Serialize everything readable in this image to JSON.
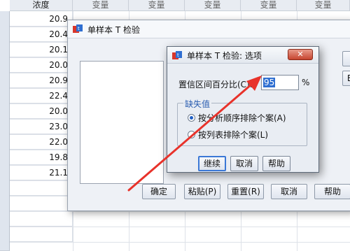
{
  "sheet": {
    "column_header": "浓度",
    "var_header": "变量",
    "var_columns": 5,
    "values": [
      "20.9",
      "20.4",
      "20.1",
      "20.0",
      "20.9",
      "22.4",
      "20.0",
      "23.0",
      "22.0",
      "19.8",
      "21.1"
    ]
  },
  "main_dialog": {
    "title": "单样本 T 检验",
    "buttons": {
      "ok": "确定",
      "paste": "粘贴(P)",
      "reset": "重置(R)",
      "cancel": "取消",
      "help": "帮助"
    },
    "side_buttons": [
      "",
      "B"
    ]
  },
  "options_dialog": {
    "title": "单样本 T 检验: 选项",
    "close_label": "✕",
    "ci_label": "置信区间百分比(C):",
    "ci_value": "95",
    "ci_unit": "%",
    "missing_legend": "缺失值",
    "radio_by_analysis": "按分析顺序排除个案(A)",
    "radio_listwise": "按列表排除个案(L)",
    "buttons": {
      "continue": "继续",
      "cancel": "取消",
      "help": "帮助"
    }
  },
  "annotation": {
    "arrow_color": "#e8322a"
  }
}
